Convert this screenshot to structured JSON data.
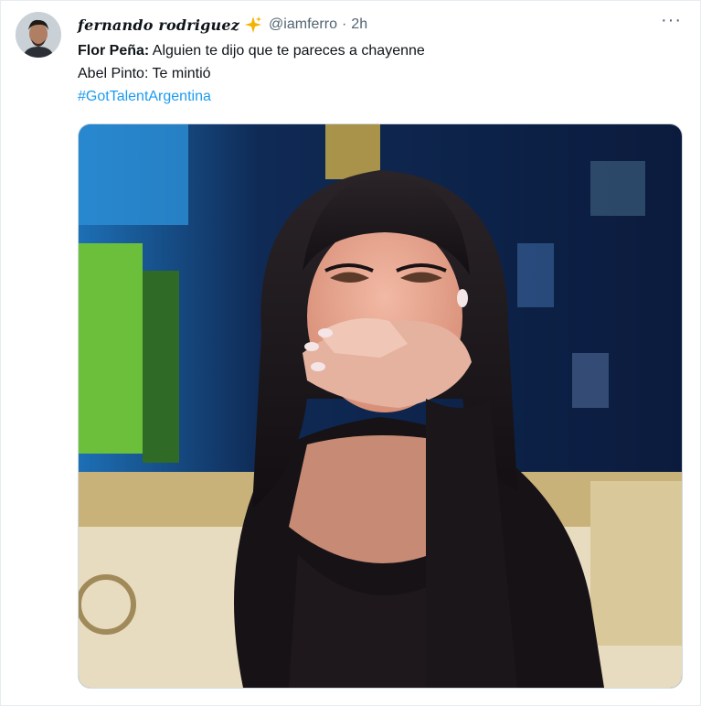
{
  "author": {
    "display_name": "fernando rodriguez",
    "handle": "@iamferro",
    "separator": "·",
    "time": "2h",
    "badge_icon": "sparkle-icon",
    "avatar_icon": "avatar"
  },
  "more_label": "···",
  "tweet": {
    "line1_speaker": "Flor Peña:",
    "line1_text": " Alguien te dijo que te pareces a chayenne",
    "line2": "Abel Pinto: Te mintió",
    "hashtag": "#GotTalentArgentina"
  },
  "media": {
    "type": "image",
    "description_icon": "tv-show-photo"
  },
  "colors": {
    "link": "#1d9bf0",
    "text": "#0f1419",
    "secondary": "#536471",
    "sparkle": "#f5b301"
  }
}
